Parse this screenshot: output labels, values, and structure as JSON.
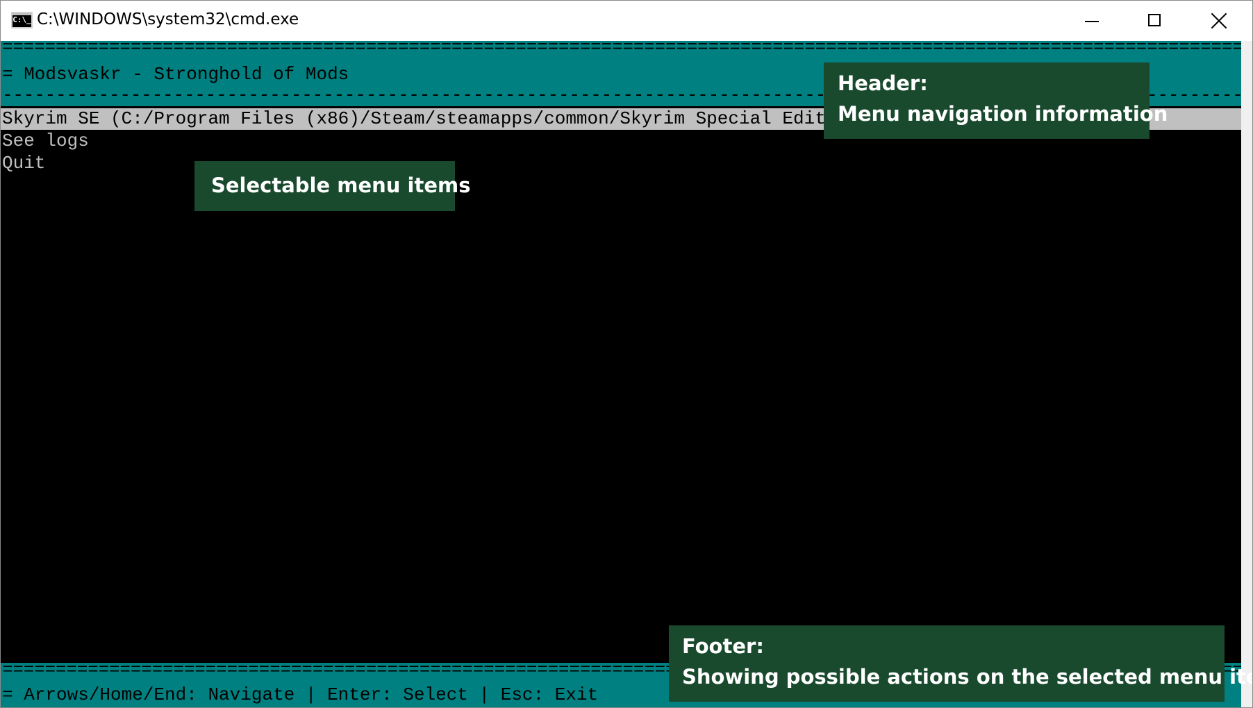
{
  "window": {
    "title": "C:\\WINDOWS\\system32\\cmd.exe",
    "icon_text": "C:\\_",
    "controls": [
      "minimize-icon",
      "maximize-icon",
      "close-icon"
    ]
  },
  "console": {
    "colors": {
      "background": "#000000",
      "band": "#008080",
      "text": "#c0c0c0",
      "highlight": "#c0c0c0"
    },
    "header": {
      "rule_top": "============================================================================================================================================",
      "title": "= Modsvaskr - Stronghold of Mods",
      "rule_bottom": "------------------------------------------------------------------------------------------------------------------------------------------"
    },
    "menu": {
      "items": [
        "Skyrim SE (C:/Program Files (x86)/Steam/steamapps/common/Skyrim Special Edition",
        "See logs",
        "Quit"
      ],
      "selected_index": 0
    },
    "footer": {
      "rule": "============================================================================================================================================",
      "actions": "= Arrows/Home/End: Navigate | Enter: Select | Esc: Exit"
    }
  },
  "annotations": {
    "header": {
      "title": "Header:",
      "text": "Menu navigation information"
    },
    "menu": {
      "text": "Selectable menu items"
    },
    "footer": {
      "title": "Footer:",
      "text": "Showing possible actions on the selected menu item"
    },
    "color": "#1a4a2e"
  }
}
